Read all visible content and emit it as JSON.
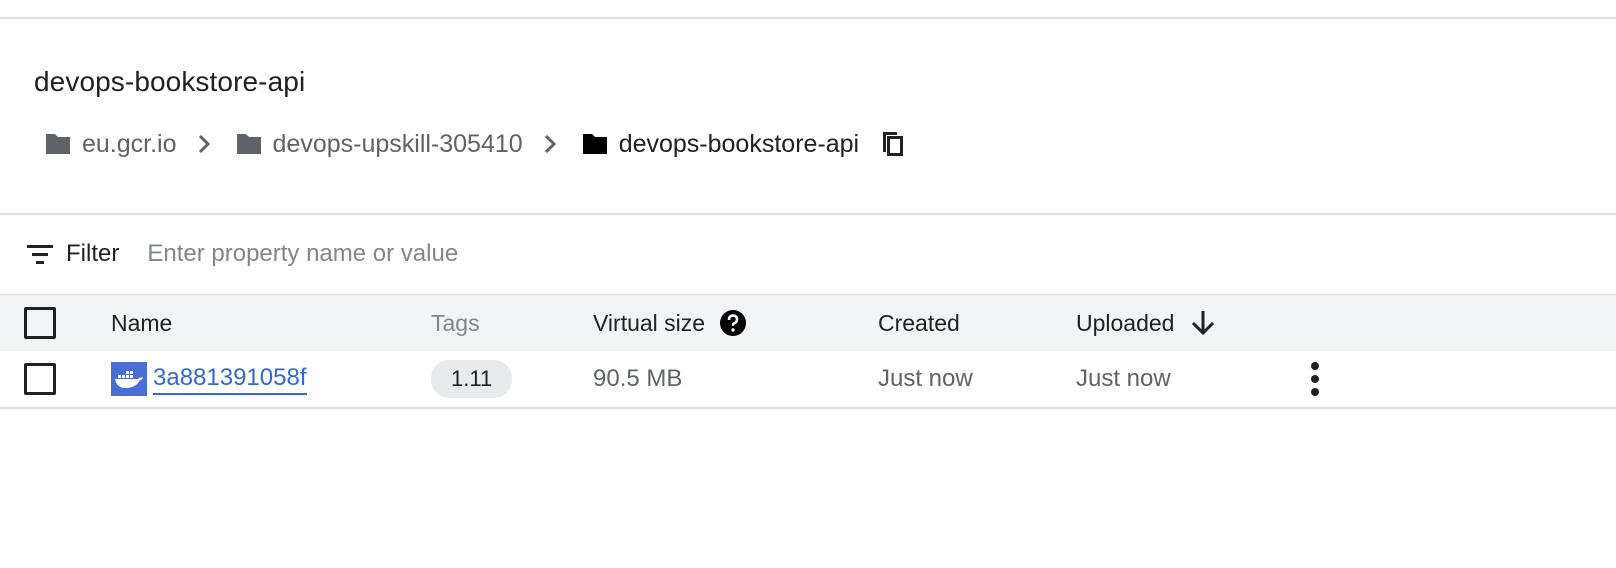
{
  "page": {
    "title": "devops-bookstore-api",
    "breadcrumb": [
      {
        "label": "eu.gcr.io"
      },
      {
        "label": "devops-upskill-305410"
      },
      {
        "label": "devops-bookstore-api"
      }
    ]
  },
  "filter": {
    "label": "Filter",
    "placeholder": "Enter property name or value"
  },
  "table": {
    "columns": {
      "name": "Name",
      "tags": "Tags",
      "virtual_size": "Virtual size",
      "created": "Created",
      "uploaded": "Uploaded"
    },
    "rows": [
      {
        "name": "3a881391058f",
        "tag": "1.11",
        "virtual_size": "90.5 MB",
        "created": "Just now",
        "uploaded": "Just now"
      }
    ]
  },
  "icons": {
    "folder": "folder-icon",
    "chevron": "chevron-right-icon",
    "copy": "copy-icon",
    "filter": "filter-icon",
    "help": "help-icon",
    "sort": "arrow-down-icon",
    "docker": "docker-icon",
    "more": "more-vert-icon"
  },
  "colors": {
    "link": "#3367d6",
    "docker_bg": "#4a6ed6",
    "header_bg": "#f1f3f4",
    "chip_bg": "#e8eaed"
  }
}
